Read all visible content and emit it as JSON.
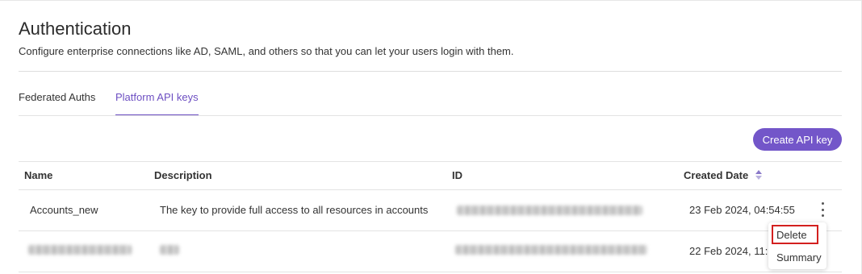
{
  "header": {
    "title": "Authentication",
    "subtitle": "Configure enterprise connections like AD, SAML, and others so that you can let your users login with them."
  },
  "tabs": [
    {
      "label": "Federated Auths",
      "active": false
    },
    {
      "label": "Platform API keys",
      "active": true
    }
  ],
  "toolbar": {
    "create_label": "Create API key"
  },
  "table": {
    "columns": [
      "Name",
      "Description",
      "ID",
      "Created Date"
    ],
    "rows": [
      {
        "name": "Accounts_new",
        "description": "The key to provide full access to all resources in accounts",
        "id": "",
        "created": "23 Feb 2024, 04:54:55"
      },
      {
        "name": "",
        "description": "",
        "id": "",
        "created": "22 Feb 2024, 11:1"
      }
    ]
  },
  "menu": {
    "items": [
      "Delete",
      "Summary"
    ]
  },
  "colors": {
    "accent": "#7356c9",
    "highlight": "#d3201f"
  }
}
